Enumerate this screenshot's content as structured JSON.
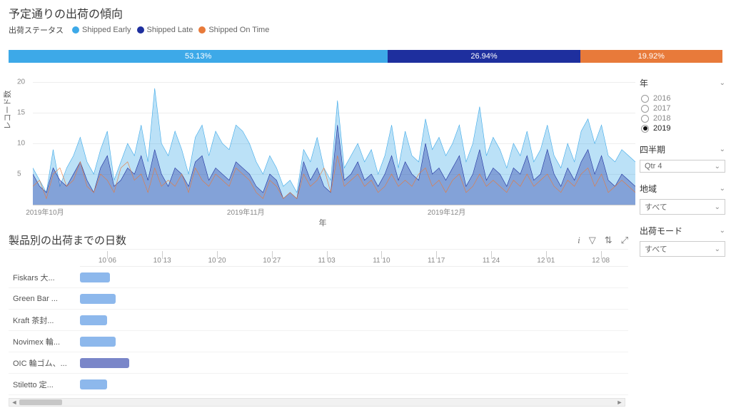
{
  "title": "予定通りの出荷の傾向",
  "legend_label": "出荷ステータス",
  "legend": [
    {
      "label": "Shipped Early",
      "color": "#3da9e8"
    },
    {
      "label": "Shipped Late",
      "color": "#1e2f9e"
    },
    {
      "label": "Shipped On Time",
      "color": "#e87a3a"
    }
  ],
  "pct_bar": [
    {
      "label": "53.13%",
      "pct": 53.13,
      "color": "#3da9e8"
    },
    {
      "label": "26.94%",
      "pct": 26.94,
      "color": "#1e2f9e"
    },
    {
      "label": "19.92%",
      "pct": 19.92,
      "color": "#e87a3a"
    }
  ],
  "chart_data": {
    "area": {
      "type": "area",
      "ylabel": "レコード数",
      "xlabel": "年",
      "ylim": [
        0,
        22
      ],
      "yticks": [
        5,
        10,
        15,
        20
      ],
      "xticks": [
        "2019年10月",
        "2019年11月",
        "2019年12月"
      ],
      "n": 90,
      "series": [
        {
          "name": "Shipped Early",
          "color": "#3da9e8",
          "fill": "rgba(61,169,232,0.35)",
          "values": [
            6,
            4,
            2,
            9,
            3,
            6,
            8,
            11,
            7,
            5,
            9,
            12,
            4,
            7,
            10,
            8,
            13,
            7,
            19,
            10,
            8,
            12,
            9,
            5,
            11,
            13,
            8,
            12,
            10,
            9,
            13,
            12,
            10,
            7,
            5,
            8,
            6,
            3,
            4,
            2,
            9,
            7,
            11,
            6,
            4,
            17,
            6,
            8,
            10,
            7,
            9,
            5,
            8,
            13,
            6,
            12,
            8,
            7,
            14,
            9,
            11,
            8,
            10,
            13,
            7,
            10,
            16,
            8,
            11,
            9,
            6,
            10,
            8,
            12,
            7,
            9,
            13,
            8,
            6,
            10,
            7,
            12,
            14,
            10,
            13,
            8,
            7,
            9,
            8,
            7
          ]
        },
        {
          "name": "Shipped Late",
          "color": "#1e2f9e",
          "fill": "rgba(30,47,158,0.35)",
          "values": [
            5,
            3,
            2,
            6,
            4,
            3,
            5,
            7,
            4,
            2,
            6,
            8,
            3,
            4,
            6,
            5,
            8,
            4,
            9,
            5,
            3,
            6,
            5,
            3,
            7,
            8,
            4,
            6,
            5,
            4,
            7,
            6,
            5,
            3,
            2,
            5,
            4,
            1,
            2,
            1,
            7,
            4,
            6,
            3,
            2,
            13,
            4,
            5,
            7,
            4,
            5,
            3,
            5,
            8,
            4,
            7,
            5,
            4,
            10,
            5,
            6,
            4,
            6,
            8,
            3,
            5,
            9,
            4,
            6,
            5,
            3,
            6,
            5,
            8,
            4,
            5,
            9,
            5,
            3,
            6,
            4,
            7,
            9,
            5,
            8,
            4,
            3,
            5,
            4,
            3
          ]
        },
        {
          "name": "Shipped On Time",
          "color": "#e87a3a",
          "fill": "none",
          "values": [
            3,
            4,
            1,
            5,
            6,
            3,
            4,
            7,
            3,
            2,
            5,
            4,
            2,
            6,
            7,
            4,
            5,
            2,
            6,
            3,
            4,
            3,
            5,
            2,
            6,
            4,
            3,
            5,
            4,
            3,
            6,
            5,
            4,
            2,
            1,
            4,
            3,
            1,
            2,
            1,
            5,
            3,
            4,
            6,
            2,
            8,
            3,
            4,
            5,
            3,
            4,
            2,
            3,
            5,
            3,
            4,
            3,
            5,
            6,
            3,
            4,
            2,
            4,
            5,
            2,
            3,
            5,
            3,
            4,
            3,
            2,
            4,
            3,
            5,
            3,
            4,
            5,
            3,
            2,
            4,
            3,
            5,
            6,
            3,
            5,
            2,
            3,
            4,
            3,
            2
          ]
        }
      ]
    },
    "gantt": {
      "type": "bar",
      "title": "製品別の出荷までの日数",
      "timeline": [
        "10 06",
        "10 13",
        "10 20",
        "10 27",
        "11 03",
        "11 10",
        "11 17",
        "11 24",
        "12 01",
        "12 08"
      ],
      "rows": [
        {
          "label": "Fiskars 大...",
          "start": 0,
          "len": 5.5,
          "color": "#8db8ec"
        },
        {
          "label": "Green Bar ...",
          "start": 0,
          "len": 6.5,
          "color": "#8db8ec"
        },
        {
          "label": "Kraft 茶封...",
          "start": 0,
          "len": 5.0,
          "color": "#8db8ec"
        },
        {
          "label": "Novimex 輪...",
          "start": 0,
          "len": 6.5,
          "color": "#8db8ec"
        },
        {
          "label": "OIC 輪ゴム、...",
          "start": 0,
          "len": 9.0,
          "color": "#7a86c9"
        },
        {
          "label": "Stiletto 定...",
          "start": 0,
          "len": 5.0,
          "color": "#8db8ec"
        }
      ]
    }
  },
  "filters": {
    "year": {
      "title": "年",
      "options": [
        "2016",
        "2017",
        "2018",
        "2019"
      ],
      "selected": "2019"
    },
    "quarter": {
      "title": "四半期",
      "value": "Qtr 4"
    },
    "region": {
      "title": "地域",
      "value": "すべて"
    },
    "ship_mode": {
      "title": "出荷モード",
      "value": "すべて"
    }
  },
  "gantt_icons": {
    "info": "i",
    "filter": "filter-icon",
    "sort": "sort-icon",
    "expand": "expand-icon"
  }
}
